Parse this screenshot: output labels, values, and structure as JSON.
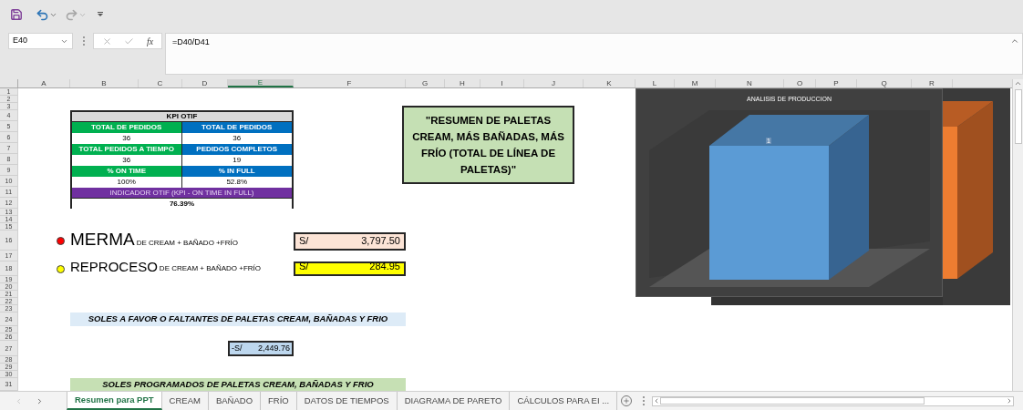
{
  "name_box": "E40",
  "function_label": "fx",
  "formula": "=D40/D41",
  "columns": [
    {
      "label": "A",
      "selected": false
    },
    {
      "label": "B",
      "selected": false
    },
    {
      "label": "C",
      "selected": false
    },
    {
      "label": "D",
      "selected": false
    },
    {
      "label": "E",
      "selected": true
    },
    {
      "label": "F",
      "selected": false
    },
    {
      "label": "G",
      "selected": false
    },
    {
      "label": "H",
      "selected": false
    },
    {
      "label": "I",
      "selected": false
    },
    {
      "label": "J",
      "selected": false
    },
    {
      "label": "K",
      "selected": false
    },
    {
      "label": "L",
      "selected": false
    },
    {
      "label": "M",
      "selected": false
    },
    {
      "label": "N",
      "selected": false
    },
    {
      "label": "O",
      "selected": false
    },
    {
      "label": "P",
      "selected": false
    },
    {
      "label": "Q",
      "selected": false
    },
    {
      "label": "R",
      "selected": false
    }
  ],
  "rows": [
    "1",
    "2",
    "3",
    "4",
    "5",
    "6",
    "7",
    "8",
    "9",
    "10",
    "11",
    "12",
    "13",
    "14",
    "15",
    "16",
    "17",
    "18",
    "19",
    "20",
    "21",
    "22",
    "23",
    "24",
    "25",
    "26",
    "27",
    "28",
    "29",
    "30",
    "31"
  ],
  "kpi_table": {
    "title": "KPI OTIF",
    "rows": [
      {
        "kind": "header",
        "cells": [
          "TOTAL DE PEDIDOS",
          "TOTAL DE PEDIDOS"
        ]
      },
      {
        "kind": "value",
        "cells": [
          "36",
          "36"
        ]
      },
      {
        "kind": "header",
        "cells": [
          "TOTAL PEDIDOS A TIEMPO",
          "PEDIDOS COMPLETOS"
        ]
      },
      {
        "kind": "value",
        "cells": [
          "36",
          "19"
        ]
      },
      {
        "kind": "header",
        "cells": [
          "% ON TIME",
          "% IN FULL"
        ]
      },
      {
        "kind": "value",
        "cells": [
          "100%",
          "52.8%"
        ]
      }
    ],
    "indicator_label": "INDICADOR OTIF (KPI - ON TIME IN FULL)",
    "indicator_value": "76.39%"
  },
  "indicators": [
    {
      "kind": "merma",
      "name": "MERMA",
      "detail": "DE CREAM + BAÑADO +FRÍO",
      "color": "#ff0000",
      "currency": "S/",
      "amount": "3,797.50"
    },
    {
      "kind": "reproceso",
      "name": "REPROCESO",
      "detail": "DE CREAM + BAÑADO +FRÍO",
      "color": "#ffff00",
      "currency": "S/",
      "amount": "284.95"
    }
  ],
  "soles_favor": {
    "title": "SOLES A FAVOR O FALTANTES DE PALETAS CREAM, BAÑADAS Y FRIO",
    "currency": "-S/",
    "amount": "2,449.76"
  },
  "soles_programados": {
    "title": "SOLES PROGRAMADOS DE PALETAS CREAM, BAÑADAS Y FRIO"
  },
  "text_box": "\"RESUMEN DE PALETAS CREAM, MÁS BAÑADAS, MÁS FRÍO (TOTAL DE LÍNEA DE PALETAS)\"",
  "chart": {
    "title": "ANALISIS DE PRODUCCION",
    "data_label": "1"
  },
  "sheet_tabs": [
    {
      "label": "Resumen para PPT",
      "selected": true
    },
    {
      "label": "CREAM",
      "selected": false
    },
    {
      "label": "BAÑADO",
      "selected": false
    },
    {
      "label": "FRÍO",
      "selected": false
    },
    {
      "label": "DATOS DE TIEMPOS",
      "selected": false
    },
    {
      "label": "DIAGRAMA DE PARETO",
      "selected": false
    },
    {
      "label": "CÁLCULOS PARA EI ...",
      "selected": false
    }
  ]
}
